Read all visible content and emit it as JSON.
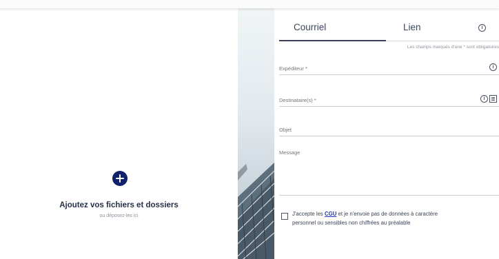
{
  "upload": {
    "title": "Ajoutez vos fichiers et dossiers",
    "subtitle": "ou déposez-les ici",
    "add_icon": "plus-circle-icon"
  },
  "tabs": [
    {
      "label": "Courriel",
      "active": true
    },
    {
      "label": "Lien",
      "active": false
    }
  ],
  "required_note": "Les champs marqués d'une * sont obligatoires",
  "fields": {
    "sender": {
      "placeholder": "Expéditeur *",
      "value": ""
    },
    "recipients": {
      "placeholder": "Destinataire(s) *",
      "value": ""
    },
    "subject": {
      "placeholder": "Objet",
      "value": ""
    },
    "message": {
      "placeholder": "Message",
      "value": ""
    }
  },
  "consent": {
    "prefix": "J'accepte les",
    "link": "CGU",
    "line1_suffix": "et je n'envoie pas de données à caractère",
    "line2": "personnel ou sensibles non chiffrées au préalable",
    "checked": false
  },
  "icons": {
    "info": "info-icon",
    "list": "list-icon"
  },
  "colors": {
    "accent": "#10216b",
    "link": "#1a36b5"
  }
}
